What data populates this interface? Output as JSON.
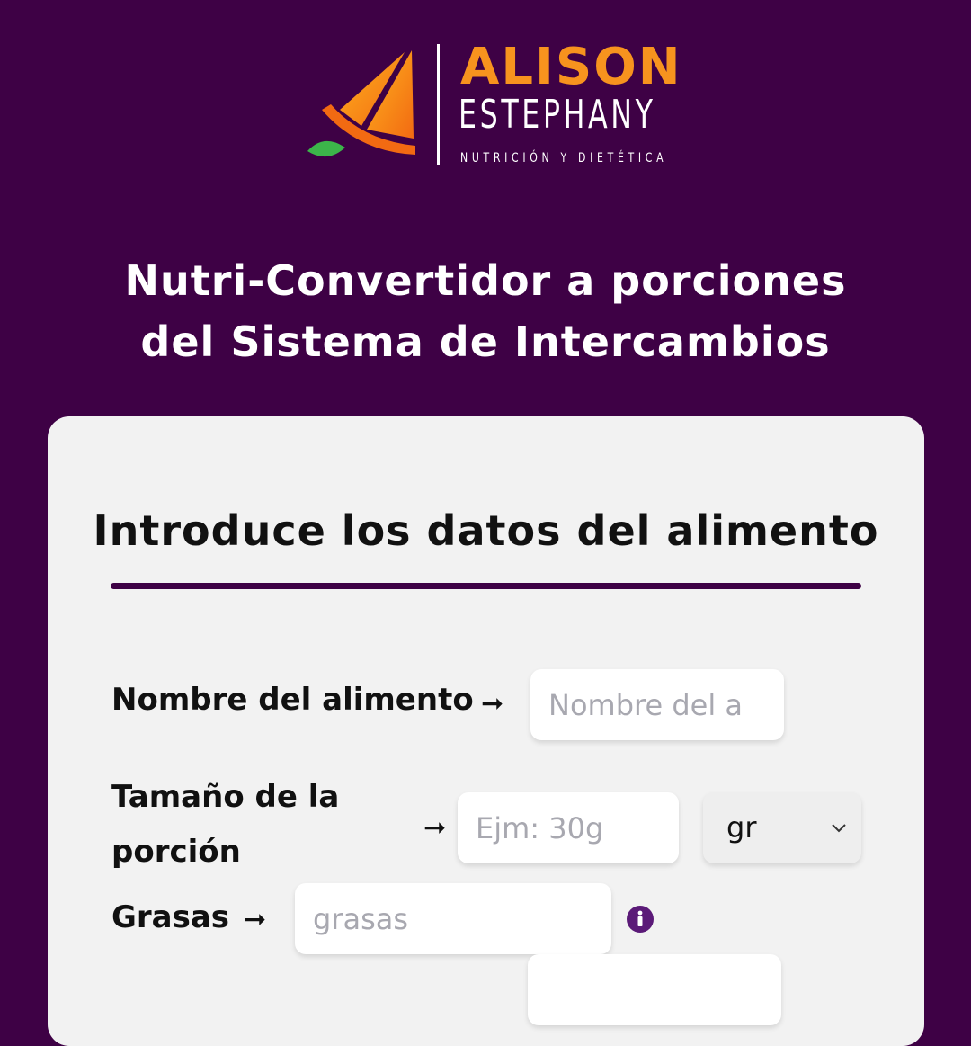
{
  "brand": {
    "name": "ALISON",
    "subname": "ESTEPHANY",
    "tagline": "NUTRICIÓN Y DIETÉTICA",
    "colors": {
      "orange": "#f7931e",
      "leaf": "#3cb54a",
      "background": "#3e0145"
    }
  },
  "hero": {
    "title_line1": "Nutri-Convertidor a porciones",
    "title_line2": "del Sistema de Intercambios"
  },
  "form": {
    "title": "Introduce los datos del alimento",
    "fields": {
      "food_name": {
        "label": "Nombre del alimento",
        "arrow": "➞",
        "placeholder": "Nombre del a",
        "value": ""
      },
      "portion_size": {
        "label_line1": "Tamaño de la",
        "label_line2": "porción",
        "arrow": "➞",
        "placeholder": "Ejm: 30g",
        "value": "",
        "unit_selected": "gr"
      },
      "fats": {
        "label": "Grasas",
        "arrow": "➞",
        "placeholder": "grasas",
        "value": "",
        "info_icon": "info-icon"
      }
    }
  }
}
